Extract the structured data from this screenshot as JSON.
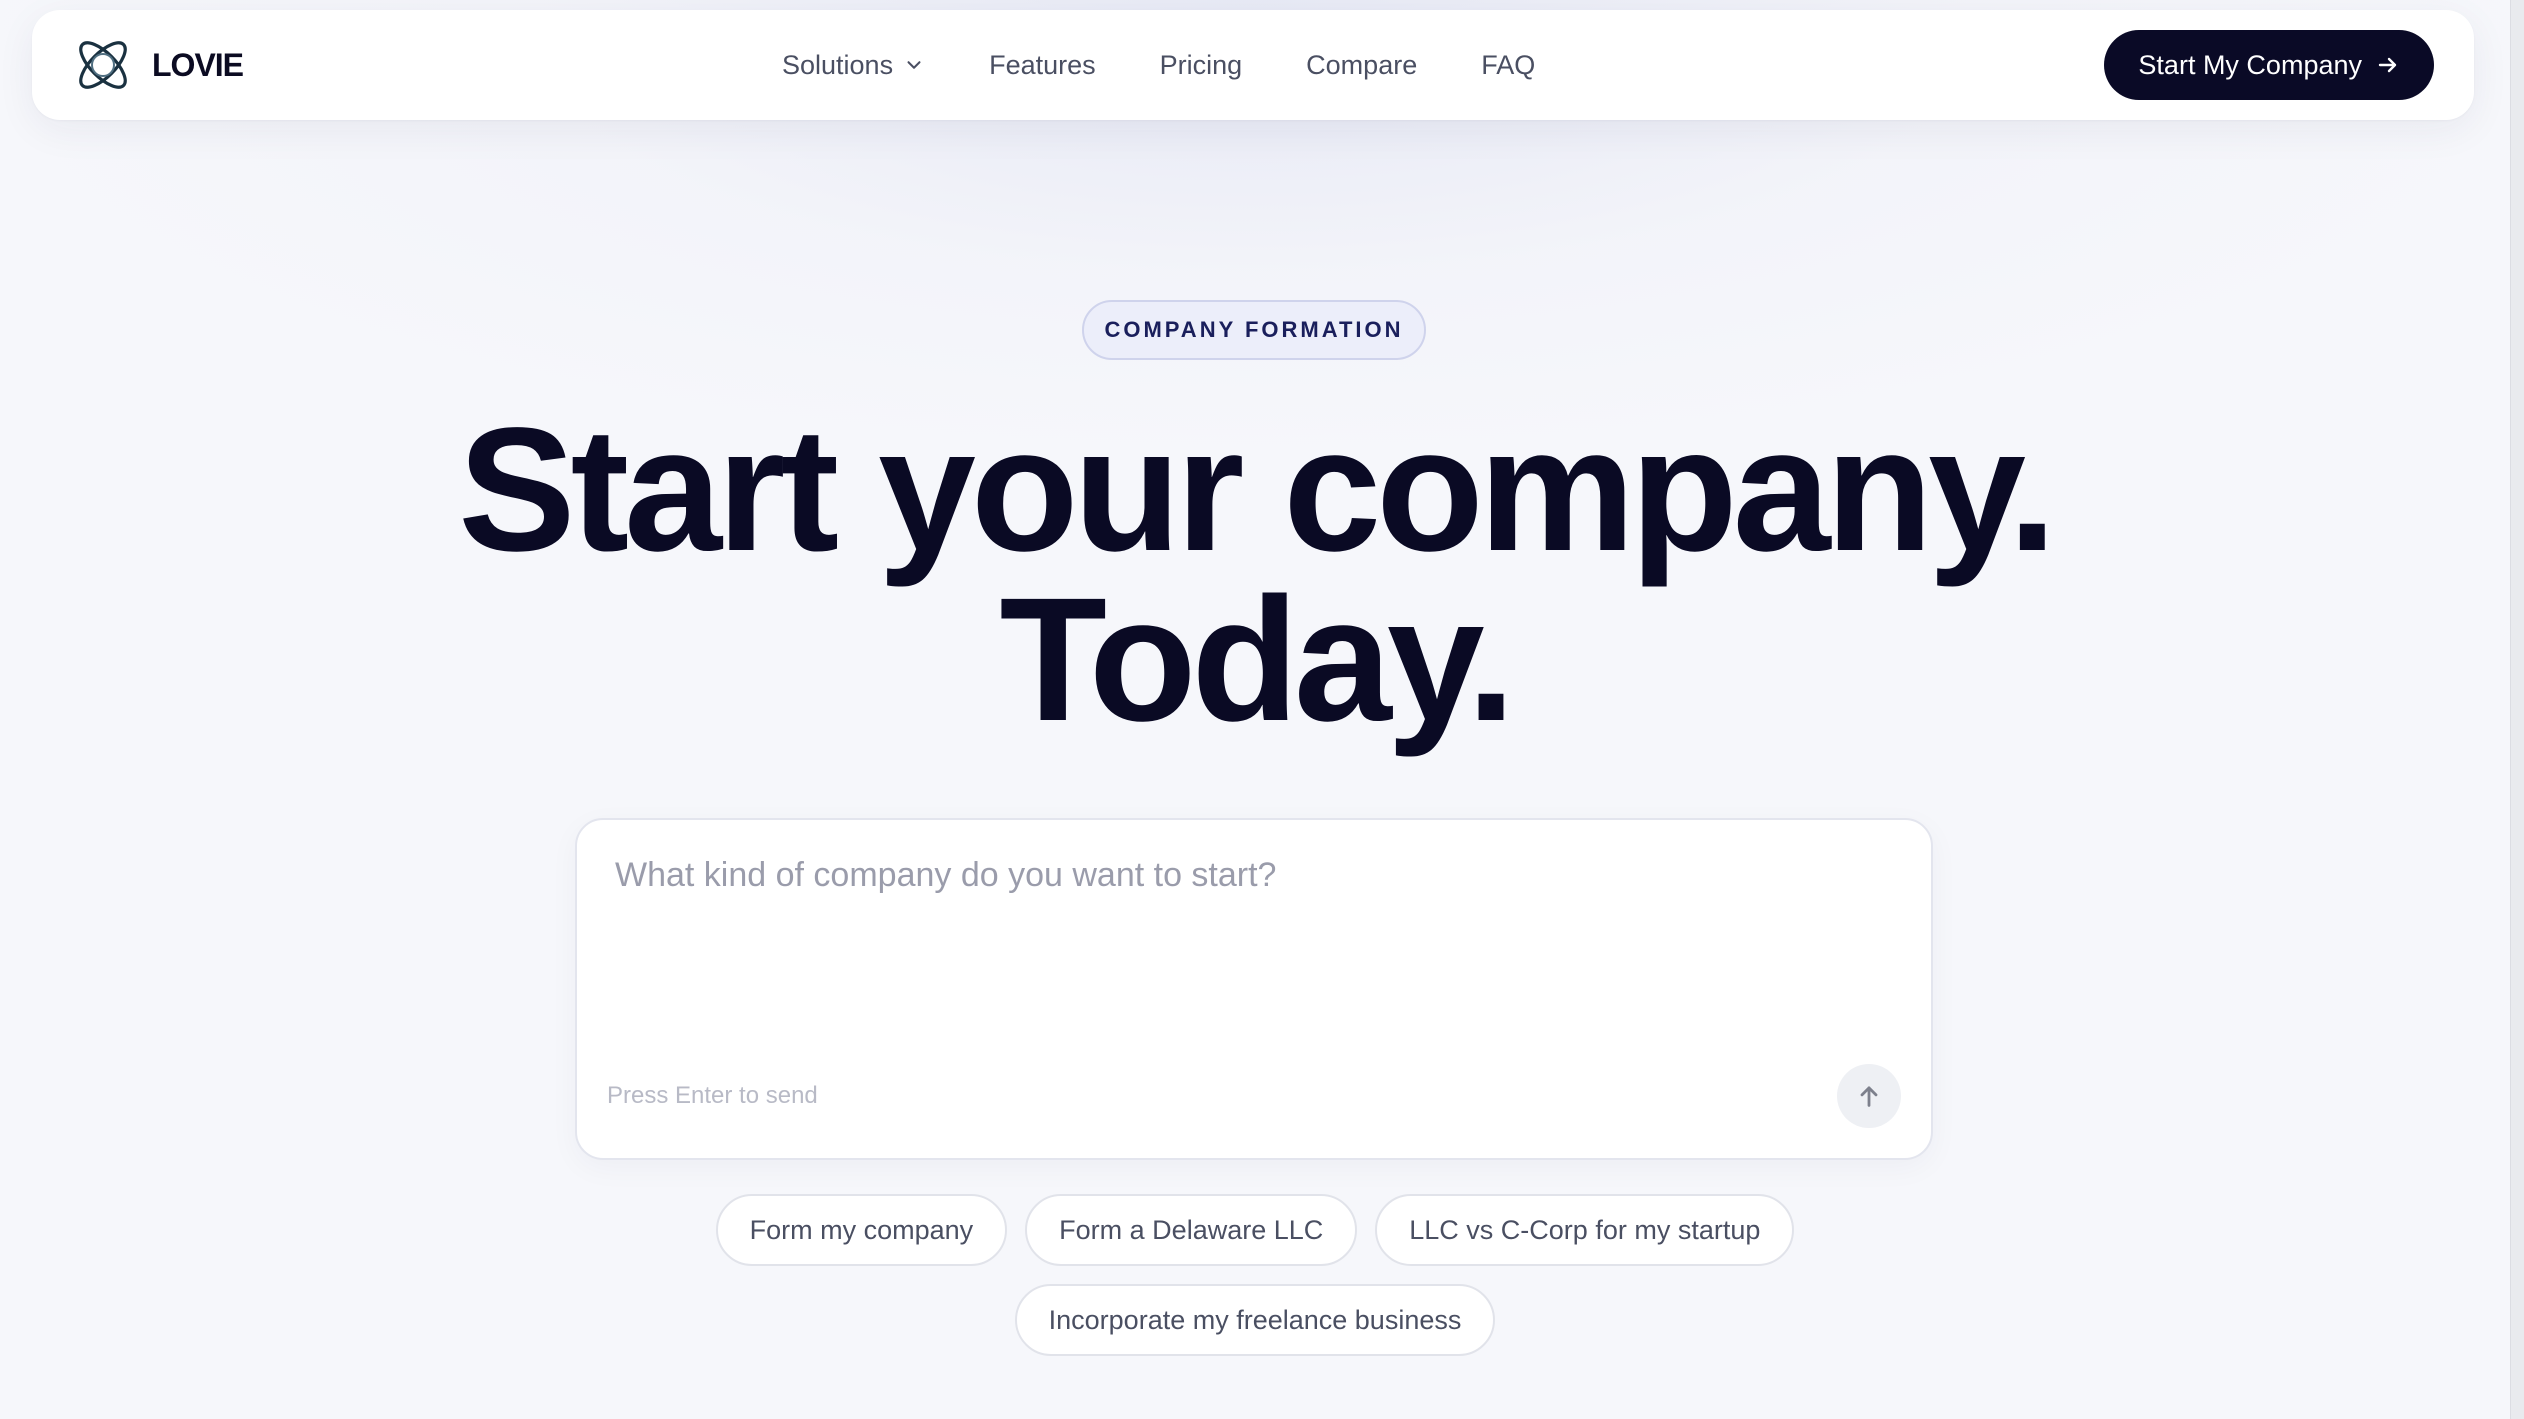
{
  "brand": {
    "name": "LOVIE",
    "logo_icon": "interlocking-rings-logo",
    "accent_color": "#0a0a26"
  },
  "nav": {
    "items": [
      {
        "label": "Solutions",
        "has_dropdown": true
      },
      {
        "label": "Features"
      },
      {
        "label": "Pricing"
      },
      {
        "label": "Compare"
      },
      {
        "label": "FAQ"
      }
    ],
    "cta_label": "Start My Company",
    "cta_icon": "arrow-right-icon"
  },
  "hero": {
    "badge": "COMPANY FORMATION",
    "headline_line1": "Start your company.",
    "headline_line2": "Today."
  },
  "prompt": {
    "placeholder": "What kind of company do you want to start?",
    "value": "",
    "hint": "Press Enter to send",
    "send_icon": "arrow-up-icon"
  },
  "suggestions": [
    "Form my company",
    "Form a Delaware LLC",
    "LLC vs C-Corp for my startup",
    "Incorporate my freelance business"
  ]
}
